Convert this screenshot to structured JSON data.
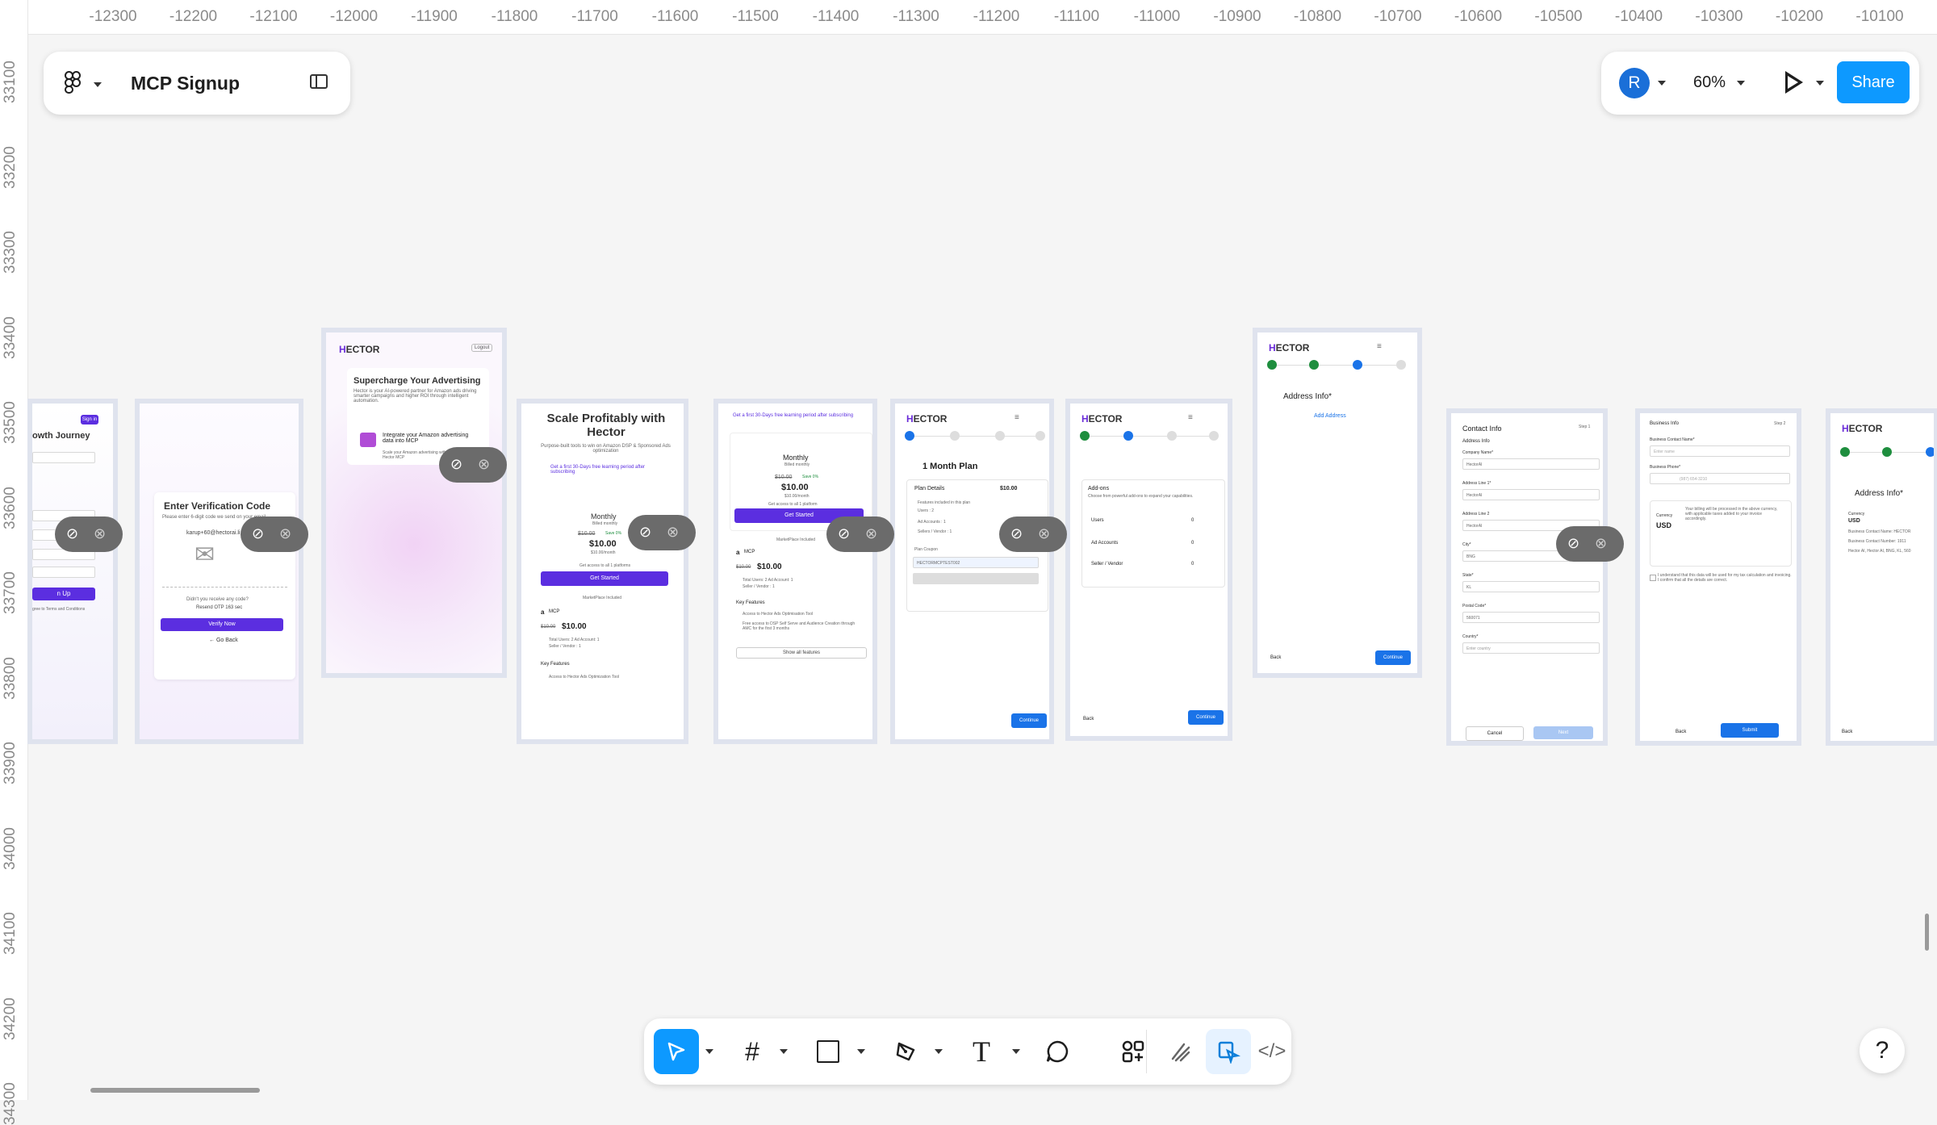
{
  "rulers": {
    "top": [
      "-12300",
      "-12200",
      "-12100",
      "-12000",
      "-11900",
      "-11800",
      "-11700",
      "-11600",
      "-11500",
      "-11400",
      "-11300",
      "-11200",
      "-11100",
      "-11000",
      "-10900",
      "-10800",
      "-10700",
      "-10600",
      "-10500",
      "-10400",
      "-10300",
      "-10200",
      "-10100"
    ],
    "left": [
      "33100",
      "33200",
      "33300",
      "33400",
      "33500",
      "33600",
      "33700",
      "33800",
      "33900",
      "34000",
      "34100",
      "34200",
      "34300"
    ]
  },
  "file": {
    "name": "MCP Signup"
  },
  "right_panel": {
    "avatar": "R",
    "zoom": "60%",
    "share": "Share"
  },
  "help": "?",
  "frames": {
    "f1": {
      "title": "owth Journey",
      "signin": "Sign in",
      "signup": "n Up",
      "terms": "gree to Terms and Conditions"
    },
    "f2": {
      "title": "Enter Verification Code",
      "sub": "Please enter 6-digit code we send on your email",
      "email": "karup+60@hectorai.li",
      "didnt": "Didn't you receive any code?",
      "resend": "Resend OTP 163 sec",
      "verify": "Verify Now",
      "back": "← Go Back"
    },
    "f3": {
      "logo_a": "H",
      "logo_b": "ECTOR",
      "logout": "Logout",
      "heading": "Supercharge Your Advertising",
      "desc": "Hector is your AI-powered partner for Amazon ads driving smarter campaigns and higher ROI through intelligent automation.",
      "card_title": "Integrate your Amazon advertising data into MCP",
      "card_desc": "Scale your Amazon advertising with Hector MCP"
    },
    "f4": {
      "heading": "Scale Profitably with Hector",
      "desc": "Purpose-built tools to win on Amazon DSP & Sponsored Ads optimization",
      "offer": "Get a first 30-Days free learning period after subscribing",
      "monthly": "Monthly",
      "billed": "Billed monthly",
      "old": "$10.00",
      "save": "Save 0%",
      "price": "$10.00",
      "per": "$10.00/month",
      "access": "Get access to all 1 platforms",
      "cta": "Get Started",
      "marketplace": "MarketPlace Included",
      "mcp": "MCP",
      "mcp_old": "$10.00",
      "mcp_price": "$10.00",
      "totals": "Total Users: 2  Ad Account: 1",
      "seller": "Seller / Vendor : 1",
      "key": "Key Features",
      "feat1": "Access to Hector Ads Optimization Tool"
    },
    "f5": {
      "offer": "Get a first 30-Days free learning period after subscribing",
      "monthly": "Monthly",
      "billed": "Billed monthly",
      "old": "$10.00",
      "save": "Save 0%",
      "price": "$10.00",
      "per": "$10.00/month",
      "cta": "Get Started",
      "access": "Get access to all 1 platform",
      "marketplace": "MarketPlace Included",
      "mcp": "MCP",
      "mcp_old": "$10.00",
      "mcp_price": "$10.00",
      "totals": "Total Users: 2  Ad Account: 1",
      "seller": "Seller / Vendor : 1",
      "key": "Key Features",
      "feat1": "Access to Hector Ads Optimisation Tool",
      "feat2": "Free access to DSP Self Serve and Audience Creation through AMC for the first 3 months",
      "showall": "Show all features"
    },
    "f6": {
      "title": "1 Month Plan",
      "details": "Plan Details",
      "price": "$10.00",
      "included": "Features included in this plan",
      "users": "Users : 2",
      "ad": "Ad Accounts : 1",
      "seller": "Sellers / Vendor : 1",
      "coupon_lbl": "Plan Coupon",
      "coupon": "HECTORMCPTEST002",
      "continue": "Continue"
    },
    "f7": {
      "addons": "Add-ons",
      "addons_desc": "Choose from powerful add-ons to expand your capabilities.",
      "users": "Users",
      "ad": "Ad Accounts",
      "seller": "Seller / Vendor",
      "zero": "0",
      "back": "Back",
      "continue": "Continue"
    },
    "f8": {
      "title": "Address Info*",
      "add": "Add Address",
      "back": "Back",
      "continue": "Continue"
    },
    "f9": {
      "title": "Contact Info",
      "step": "Step 1",
      "section": "Address Info",
      "company_lbl": "Company Name*",
      "company": "HectorAI",
      "addr1_lbl": "Address Line 1*",
      "addr1": "HectorAI",
      "addr2_lbl": "Address Line 2",
      "addr2": "HectorAI",
      "city_lbl": "City*",
      "city": "BNG",
      "state_lbl": "State*",
      "state": "KL",
      "postal_lbl": "Postal Code*",
      "postal": "560071",
      "country_lbl": "Country*",
      "country_ph": "Enter country",
      "cancel": "Cancel",
      "next": "Next"
    },
    "f10": {
      "title": "Business Info",
      "step": "Step 2",
      "name_lbl": "Business Contact Name*",
      "name_ph": "Enter name",
      "phone_lbl": "Business Phone*",
      "phone_ph": "(987) 654-3210",
      "currency_lbl": "Currency",
      "currency": "USD",
      "billing": "Your billing will be processed in the above currency, with applicable taxes added to your invoice accordingly.",
      "consent": "I understand that this data will be used for my tax calculation and invoicing. I confirm that all the details are correct.",
      "back": "Back",
      "submit": "Submit"
    },
    "f11": {
      "title": "Address Info*",
      "currency_lbl": "Currency",
      "currency": "USD",
      "name": "Business Contact Name: HECTOR",
      "number": "Business Contact Number: 1911",
      "addr": "Hector AI, Hector AI, BNG, KL, 560",
      "back": "Back"
    }
  },
  "colors": {
    "accent": "#0d99ff",
    "purple": "#5b2ee0",
    "blue": "#1a73e8",
    "green": "#1e8e3e"
  }
}
